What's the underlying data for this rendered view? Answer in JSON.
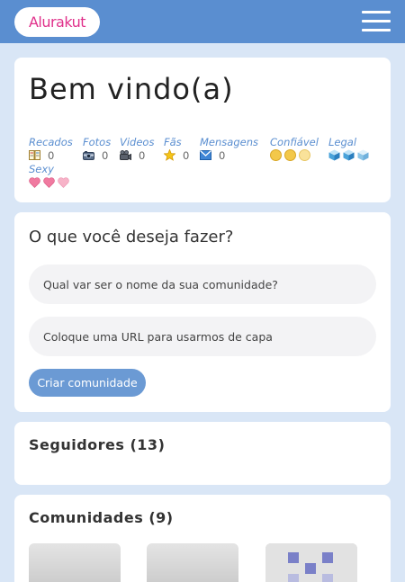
{
  "app": {
    "logo_text": "Alurakut"
  },
  "welcome": {
    "title": "Bem vindo(a)",
    "stats": [
      {
        "label": "Recados",
        "value": "0",
        "icon": "notes-icon"
      },
      {
        "label": "Fotos",
        "value": "0",
        "icon": "camera-icon"
      },
      {
        "label": "Videos",
        "value": "0",
        "icon": "video-camera-icon"
      },
      {
        "label": "Fãs",
        "value": "0",
        "icon": "star-icon"
      },
      {
        "label": "Mensagens",
        "value": "0",
        "icon": "envelope-icon"
      }
    ],
    "ratings": [
      {
        "label": "Confiável",
        "icon": "smiley-icon",
        "level": 3
      },
      {
        "label": "Legal",
        "icon": "ice-cube-icon",
        "level": 3
      },
      {
        "label": "Sexy",
        "icon": "heart-icon",
        "level": 3
      }
    ]
  },
  "create_community": {
    "title": "O que você deseja fazer?",
    "name_placeholder": "Qual var ser o nome da sua comunidade?",
    "image_placeholder": "Coloque uma URL para usarmos de capa",
    "submit_label": "Criar comunidade"
  },
  "followers": {
    "title": "Seguidores (13)"
  },
  "communities": {
    "title": "Comunidades (9)"
  },
  "colors": {
    "topbar": "#5a8ed0",
    "background": "#d9e6f6",
    "brand_pink": "#e0308a",
    "button": "#6b9ad4",
    "label": "#5a8ed0"
  }
}
